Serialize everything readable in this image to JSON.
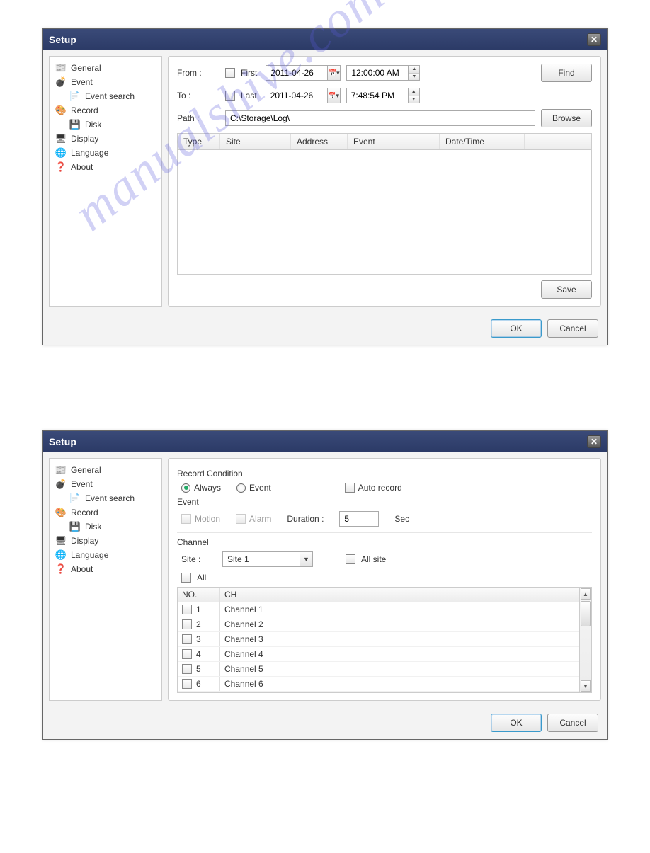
{
  "watermark": "manualshive.com",
  "dialog1": {
    "title": "Setup",
    "sidebar": [
      {
        "label": "General",
        "icon": "📰"
      },
      {
        "label": "Event",
        "icon": "💣"
      },
      {
        "label": "Event search",
        "icon": "📄",
        "child": true
      },
      {
        "label": "Record",
        "icon": "🎨"
      },
      {
        "label": "Disk",
        "icon": "💾",
        "child": true
      },
      {
        "label": "Display",
        "icon": "🖥"
      },
      {
        "label": "Language",
        "icon": "🌐"
      },
      {
        "label": "About",
        "icon": "❓"
      }
    ],
    "labels": {
      "from": "From :",
      "to": "To :",
      "path": "Path  :",
      "first": "First",
      "last": "Last"
    },
    "from_date": "2011-04-26",
    "from_time": "12:00:00 AM",
    "to_date": "2011-04-26",
    "to_time": "7:48:54 PM",
    "path_value": "C:\\Storage\\Log\\",
    "buttons": {
      "find": "Find",
      "browse": "Browse",
      "save": "Save",
      "ok": "OK",
      "cancel": "Cancel"
    },
    "columns": [
      "Type",
      "Site",
      "Address",
      "Event",
      "Date/Time"
    ]
  },
  "dialog2": {
    "title": "Setup",
    "sidebar": [
      {
        "label": "General",
        "icon": "📰"
      },
      {
        "label": "Event",
        "icon": "💣"
      },
      {
        "label": "Event search",
        "icon": "📄",
        "child": true
      },
      {
        "label": "Record",
        "icon": "🎨"
      },
      {
        "label": "Disk",
        "icon": "💾",
        "child": true
      },
      {
        "label": "Display",
        "icon": "🖥"
      },
      {
        "label": "Language",
        "icon": "🌐"
      },
      {
        "label": "About",
        "icon": "❓"
      }
    ],
    "record_condition": {
      "title": "Record Condition",
      "always": "Always",
      "event": "Event",
      "auto": "Auto record"
    },
    "event_group": {
      "title": "Event",
      "motion": "Motion",
      "alarm": "Alarm",
      "duration_label": "Duration :",
      "duration_value": "5",
      "sec": "Sec"
    },
    "channel_group": {
      "title": "Channel",
      "site_label": "Site :",
      "site_value": "Site 1",
      "allsite": "All site",
      "all": "All",
      "col_no": "NO.",
      "col_ch": "CH",
      "rows": [
        {
          "no": "1",
          "name": "Channel 1"
        },
        {
          "no": "2",
          "name": "Channel 2"
        },
        {
          "no": "3",
          "name": "Channel 3"
        },
        {
          "no": "4",
          "name": "Channel 4"
        },
        {
          "no": "5",
          "name": "Channel 5"
        },
        {
          "no": "6",
          "name": "Channel 6"
        }
      ]
    },
    "buttons": {
      "ok": "OK",
      "cancel": "Cancel"
    }
  }
}
